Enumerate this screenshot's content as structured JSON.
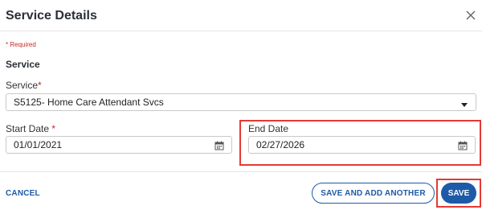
{
  "dialog": {
    "title": "Service Details",
    "required_note": "* Required",
    "section_title": "Service"
  },
  "service_field": {
    "label": "Service",
    "required_marker": "*",
    "value": "S5125- Home Care Attendant Svcs"
  },
  "start_date": {
    "label": "Start Date",
    "required_marker": "*",
    "value": "01/01/2021"
  },
  "end_date": {
    "label": "End Date",
    "value": "02/27/2026"
  },
  "footer": {
    "cancel_label": "CANCEL",
    "save_add_label": "SAVE AND ADD ANOTHER",
    "save_label": "SAVE"
  },
  "colors": {
    "primary": "#1e5aa8",
    "required_red": "#c62828",
    "highlight_red": "#e53935"
  },
  "icons": [
    "close-icon",
    "chevron-down-icon",
    "calendar-icon"
  ]
}
